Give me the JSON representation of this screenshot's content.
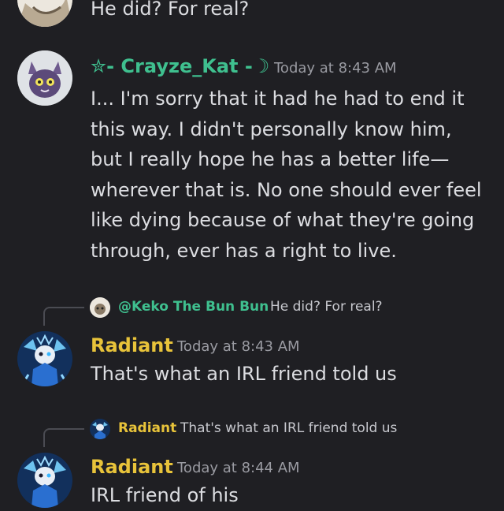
{
  "top_message": {
    "text": "He did? For real?",
    "avatar_icon": "keko-avatar-icon"
  },
  "message_crayze": {
    "username": "✮- Crayze_Kat -☽",
    "username_color": "#3fc08f",
    "timestamp": "Today at 8:43 AM",
    "avatar_icon": "cat-avatar-icon",
    "lines": [
      "I... I'm sorry that it had he had to end it",
      "this way. I didn't personally know him,",
      "but I really hope he has a better life—",
      "wherever that is. No one should ever feel",
      "like dying because of what they're going",
      "through, ever has a right to live."
    ]
  },
  "message_radiant_1": {
    "reply": {
      "name": "@Keko The Bun Bun",
      "name_color": "#3fc08f",
      "text": "He did? For real?",
      "avatar_icon": "keko-mini-avatar-icon"
    },
    "username": "Radiant",
    "username_color": "#e8c33a",
    "timestamp": "Today at 8:43 AM",
    "avatar_icon": "radiant-avatar-icon",
    "text": "That's what an IRL friend told us"
  },
  "message_radiant_2": {
    "reply": {
      "name": "Radiant",
      "name_color": "#e8c33a",
      "text": "That's what an IRL friend told us",
      "avatar_icon": "radiant-mini-avatar-icon"
    },
    "username": "Radiant",
    "username_color": "#e8c33a",
    "timestamp": "Today at 8:44 AM",
    "avatar_icon": "radiant-avatar-icon",
    "text": "IRL friend of his"
  }
}
